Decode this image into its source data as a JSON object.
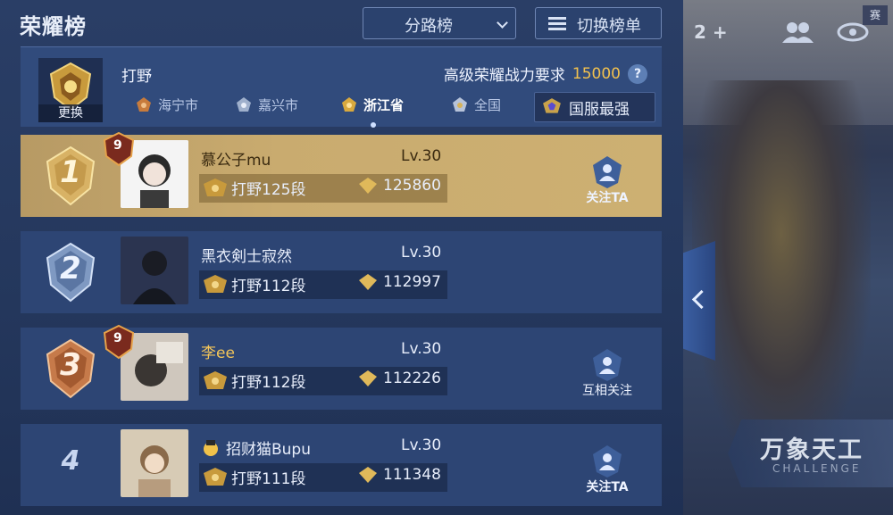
{
  "header": {
    "title": "荣耀榜",
    "filter_select": "分路榜",
    "switch_button": "切换榜单"
  },
  "role": {
    "name": "打野",
    "change_label": "更换",
    "requirement_label": "高级荣耀战力要求",
    "requirement_value": "15000",
    "help": "?"
  },
  "tabs": [
    {
      "label": "海宁市",
      "active": false
    },
    {
      "label": "嘉兴市",
      "active": false
    },
    {
      "label": "浙江省",
      "active": true
    },
    {
      "label": "全国",
      "active": false
    },
    {
      "label": "国服最强",
      "active": false
    }
  ],
  "rows": [
    {
      "rank": "1",
      "name": "慕公子mu",
      "level": "Lv.30",
      "segment": "打野125段",
      "power": "125860",
      "badge": "9",
      "follow": "关注TA",
      "name_color": "#3a2a10"
    },
    {
      "rank": "2",
      "name": "黑衣剣士寂然",
      "level": "Lv.30",
      "segment": "打野112段",
      "power": "112997",
      "badge": "",
      "follow": "",
      "name_color": "#e8eefb"
    },
    {
      "rank": "3",
      "name": "李ee",
      "level": "Lv.30",
      "segment": "打野112段",
      "power": "112226",
      "badge": "9",
      "follow": "互相关注",
      "name_color": "#f3c55a"
    },
    {
      "rank": "4",
      "name": "招财猫Bupu",
      "level": "Lv.30",
      "segment": "打野111段",
      "power": "111348",
      "badge": "",
      "follow": "关注TA",
      "name_color": "#e8eefb"
    }
  ],
  "side": {
    "count": "2",
    "tag": "赛",
    "banner_title": "万象天工",
    "banner_sub": "CHALLENGE"
  },
  "colors": {
    "gold": "#f2c14e",
    "panel": "#2d4574",
    "first_row": "#c9ab6f"
  }
}
